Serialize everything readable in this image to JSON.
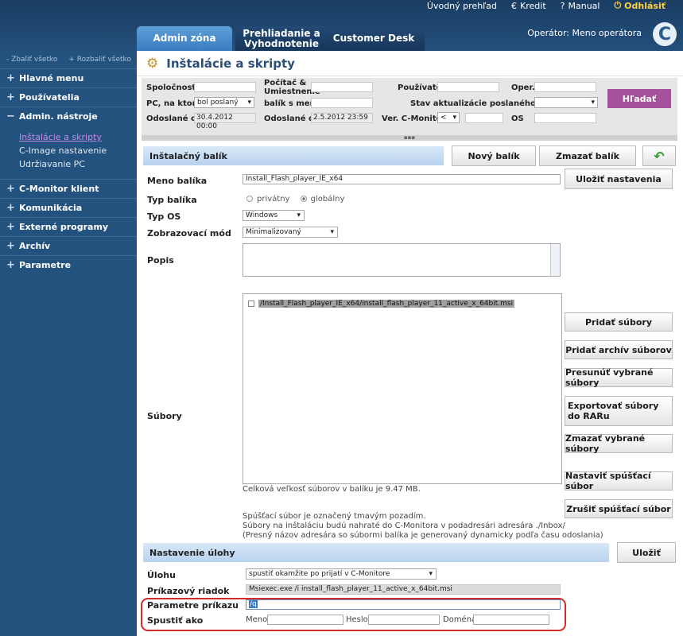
{
  "header": {
    "nav": [
      "Úvodný prehľad",
      "Kredit",
      "Manual",
      "Odhlásiť"
    ],
    "tabs": [
      "Admin zóna",
      "Prehliadanie a Vyhodnotenie",
      "Customer Desk"
    ],
    "operator": "Operátor: Meno operátora",
    "logo": "C"
  },
  "sidebar": {
    "collapse_all": "Zbaliť všetko",
    "expand_all": "Rozbaliť všetko",
    "items": [
      "Hlavné menu",
      "Používatelia",
      "Admin. nástroje",
      "C-Monitor klient",
      "Komunikácia",
      "Externé programy",
      "Archív",
      "Parametre"
    ],
    "subitems": [
      "Inštalácie a skripty",
      "C-Image nastavenie",
      "Udržiavanie PC"
    ]
  },
  "page": {
    "title": "Inštalácie a skripty"
  },
  "filter": {
    "spolocnost": "Spoločnosť",
    "pc_umiestnenie": "Počítač & Umiestnenie",
    "pouzivatel": "Používateľ",
    "oper": "Oper.",
    "pc_na_ktore": "PC, na ktoré",
    "pc_value": "bol poslaný",
    "balik_s_menom": "balík s menom",
    "stav_label": "Stav aktualizácie poslaného balíka je",
    "odoslane_od": "Odoslané od",
    "odoslane_od_value": "30.4.2012 00:00",
    "odoslane_do": "Odoslané do",
    "odoslane_do_value": "2.5.2012 23:59",
    "ver_label": "Ver. C-Monitora",
    "ver_op": "<",
    "os": "OS",
    "search": "Hľadať"
  },
  "package": {
    "section": "Inštalačný balík",
    "new_btn": "Nový balík",
    "delete_btn": "Zmazať balík",
    "save_settings": "Uložiť nastavenia",
    "name_label": "Meno balíka",
    "name_value": "Install_Flash_player_IE_x64",
    "type_label": "Typ balíka",
    "type_private": "privátny",
    "type_global": "globálny",
    "os_label": "Typ OS",
    "os_value": "Windows",
    "mode_label": "Zobrazovací mód",
    "mode_value": "Minimalizovaný",
    "desc_label": "Popis",
    "files_label": "Súbory",
    "file_item": "/Install_Flash_player_IE_x64/install_flash_player_11_active_x_64bit.msi",
    "size_note": "Celková veľkosť súborov v balíku je 9.47 MB.",
    "info_1": "Spúšťací súbor je označený tmavým pozadím.",
    "info_2": "Súbory na inštaláciu budú nahraté do C-Monitora v podadresári adresára ./Inbox/",
    "info_3": "(Presný názov adresára so súbormi balíka je generovaný dynamicky podľa času odoslania)",
    "file_buttons": [
      "Pridať súbory",
      "Pridať archív súborov",
      "Presunúť vybrané súbory",
      "Exportovať súbory do RARu",
      "Zmazať vybrané súbory",
      "Nastaviť spúšťací súbor",
      "Zrušiť spúšťací súbor"
    ]
  },
  "task": {
    "section": "Nastavenie úlohy",
    "save": "Uložiť",
    "task_label": "Úlohu",
    "task_value": "spustiť okamžite po prijatí v C-Monitore",
    "cmd_label": "Príkazový riadok",
    "cmd_value": "Msiexec.exe /i install_flash_player_11_active_x_64bit.msi",
    "params_label": "Parametre príkazu",
    "params_value": "/q",
    "run_as_label": "Spustiť ako",
    "meno": "Meno",
    "heslo": "Heslo",
    "domena": "Doména"
  }
}
